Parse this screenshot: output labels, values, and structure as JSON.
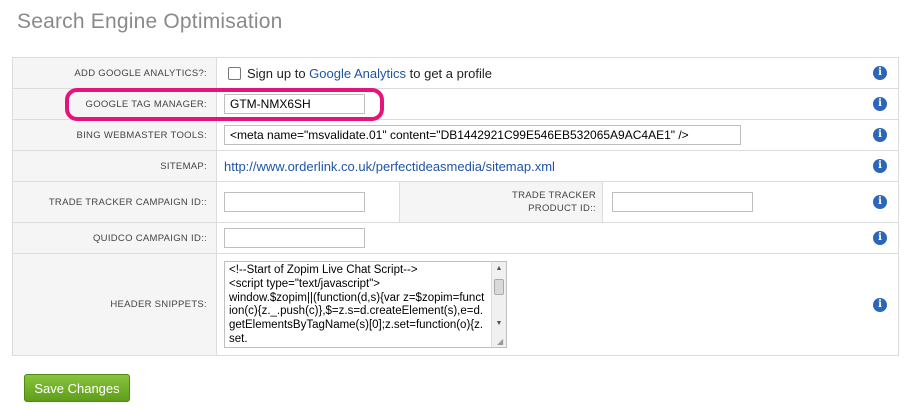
{
  "page": {
    "title": "Search Engine Optimisation"
  },
  "rows": {
    "analytics": {
      "label": "ADD GOOGLE ANALYTICS?:",
      "checkbox_text_before": "Sign up to",
      "checkbox_link": "Google Analytics",
      "checkbox_text_after": "to get a profile",
      "checked": false
    },
    "gtm": {
      "label": "GOOGLE TAG MANAGER:",
      "value": "GTM-NMX6SH"
    },
    "bing": {
      "label": "BING WEBMASTER TOOLS:",
      "value": "<meta name=\"msvalidate.01\" content=\"DB1442921C99E546EB532065A9AC4AE1\" />"
    },
    "sitemap": {
      "label": "SITEMAP:",
      "url": "http://www.orderlink.co.uk/perfectideasmedia/sitemap.xml"
    },
    "tradetracker": {
      "campaign_label": "TRADE TRACKER CAMPAIGN ID::",
      "campaign_value": "",
      "product_label_line1": "TRADE TRACKER",
      "product_label_line2": "PRODUCT ID::",
      "product_value": ""
    },
    "quidco": {
      "label": "QUIDCO CAMPAIGN ID::",
      "value": ""
    },
    "header_snippets": {
      "label": "HEADER SNIPPETS:",
      "value": "<!--Start of Zopim Live Chat Script-->\n<script type=\"text/javascript\">\nwindow.$zopim||(function(d,s){var z=$zopim=function(c){z._.push(c)},$=z.s=d.createElement(s),e=d.getElementsByTagName(s)[0];z.set=function(o){z.set.\n_.push(o)};z._=[];"
    }
  },
  "buttons": {
    "save_label": "Save Changes"
  },
  "icons": {
    "info": "info-icon"
  },
  "colors": {
    "link": "#2055a4",
    "info": "#2b66b8",
    "save": "#6aad24",
    "highlight": "#e5147d"
  }
}
